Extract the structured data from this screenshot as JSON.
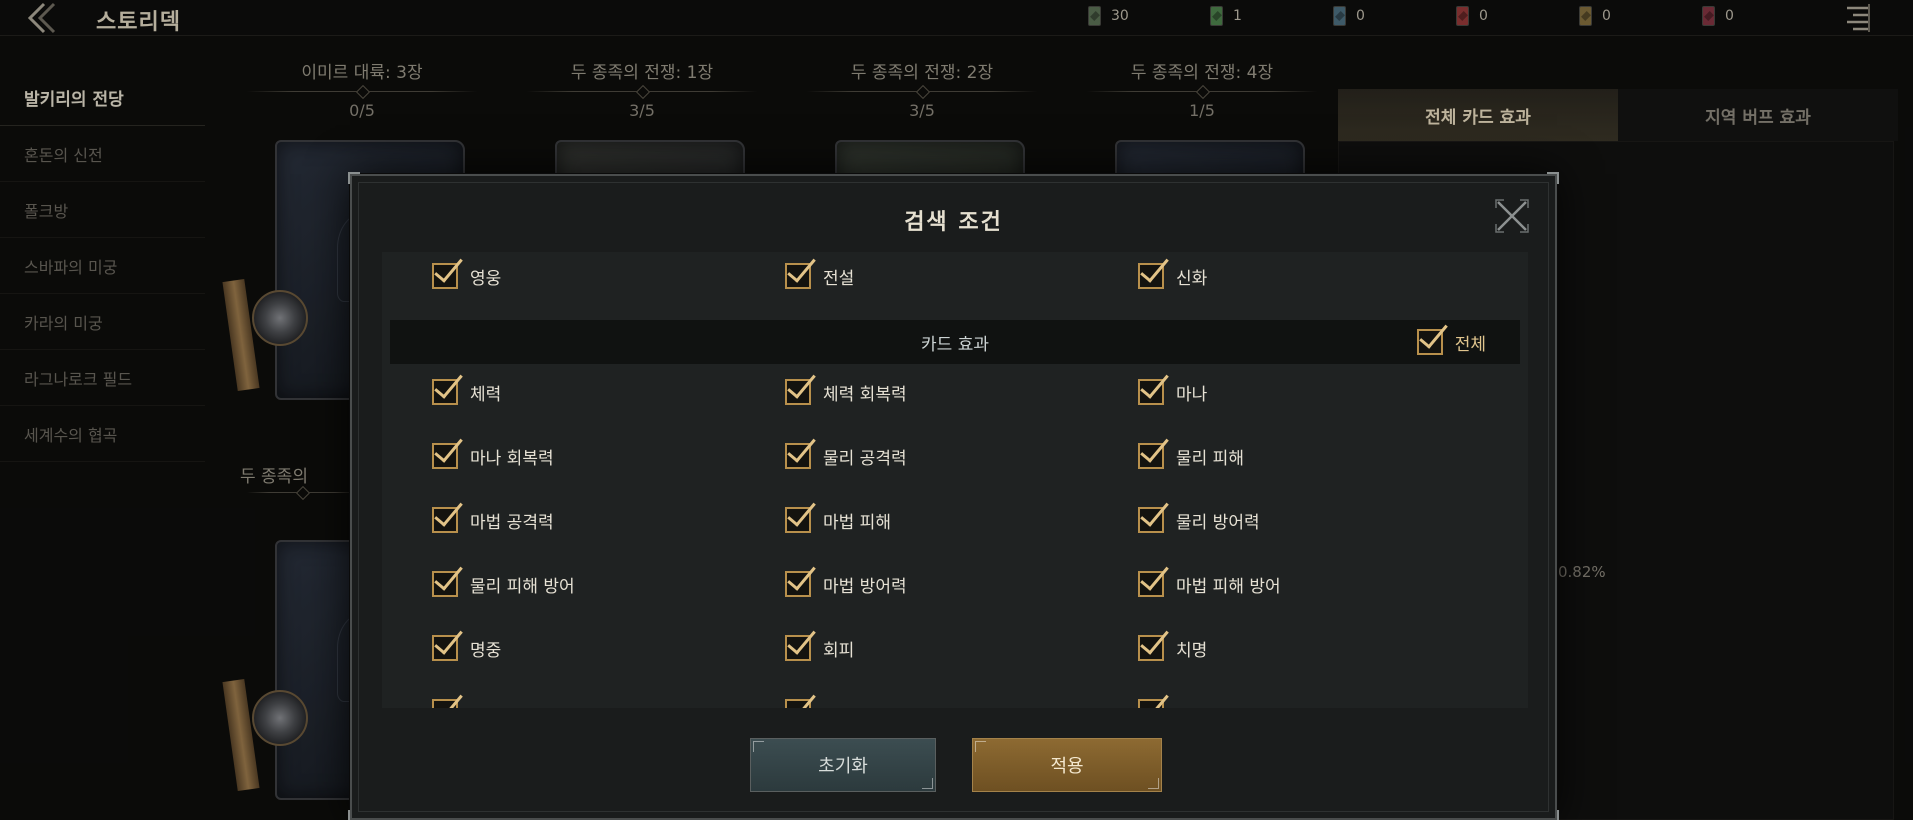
{
  "header": {
    "title": "스토리덱",
    "currencies": [
      {
        "icon": "card-green-dark-icon",
        "color": "#4a5c45",
        "value": "30"
      },
      {
        "icon": "card-green-icon",
        "color": "#3f6a3e",
        "value": "1"
      },
      {
        "icon": "card-blue-icon",
        "color": "#3e5a68",
        "value": "0"
      },
      {
        "icon": "card-red-icon",
        "color": "#7a2e2e",
        "value": "0"
      },
      {
        "icon": "card-gold-icon",
        "color": "#6b5a32",
        "value": "0"
      },
      {
        "icon": "card-crimson-icon",
        "color": "#6a2a35",
        "value": "0"
      }
    ]
  },
  "sidebar": {
    "items": [
      {
        "label": "발키리의 전당",
        "active": true
      },
      {
        "label": "혼돈의 신전",
        "active": false
      },
      {
        "label": "폴크방",
        "active": false
      },
      {
        "label": "스바파의 미궁",
        "active": false
      },
      {
        "label": "카라의 미궁",
        "active": false
      },
      {
        "label": "라그나로크 필드",
        "active": false
      },
      {
        "label": "세계수의 협곡",
        "active": false
      }
    ]
  },
  "decks": [
    {
      "title": "이미르 대륙: 3장",
      "count": "0/5"
    },
    {
      "title": "두 종족의 전쟁: 1장",
      "count": "3/5"
    },
    {
      "title": "두 종족의 전쟁: 2장",
      "count": "3/5"
    },
    {
      "title": "두 종족의 전쟁: 4장",
      "count": "1/5"
    }
  ],
  "deck_row2_title": "두 종족의",
  "right_panel": {
    "tabs": [
      {
        "label": "전체 카드 효과",
        "active": true
      },
      {
        "label": "지역 버프 효과",
        "active": false
      }
    ],
    "value": "0.82%"
  },
  "modal": {
    "title": "검색 조건",
    "grades": [
      "영웅",
      "전설",
      "신화"
    ],
    "section_label": "카드 효과",
    "all_label": "전체",
    "effects": [
      [
        "체력",
        "체력 회복력",
        "마나"
      ],
      [
        "마나 회복력",
        "물리 공격력",
        "물리 피해"
      ],
      [
        "마법 공격력",
        "마법 피해",
        "물리 방어력"
      ],
      [
        "물리 피해 방어",
        "마법 방어력",
        "마법 피해 방어"
      ],
      [
        "명중",
        "회피",
        "치명"
      ]
    ],
    "reset_label": "초기화",
    "apply_label": "적용"
  }
}
